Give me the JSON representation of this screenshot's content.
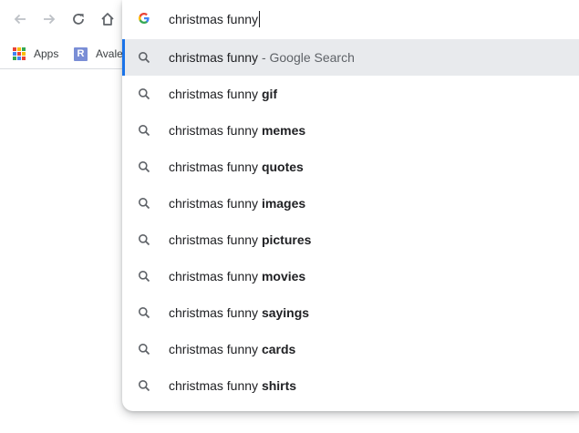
{
  "bookmarks": {
    "apps_label": "Apps",
    "avale_icon_letter": "R",
    "avale_label": "Avale"
  },
  "omnibox": {
    "value": "christmas funny"
  },
  "colors": {
    "accent": "#1a73e8",
    "selected_bg": "#e8eaed"
  },
  "suggestions": [
    {
      "prefix": "christmas funny",
      "suffix": "",
      "secondary": "- Google Search"
    },
    {
      "prefix": "christmas funny",
      "suffix": "gif",
      "secondary": ""
    },
    {
      "prefix": "christmas funny",
      "suffix": "memes",
      "secondary": ""
    },
    {
      "prefix": "christmas funny",
      "suffix": "quotes",
      "secondary": ""
    },
    {
      "prefix": "christmas funny",
      "suffix": "images",
      "secondary": ""
    },
    {
      "prefix": "christmas funny",
      "suffix": "pictures",
      "secondary": ""
    },
    {
      "prefix": "christmas funny",
      "suffix": "movies",
      "secondary": ""
    },
    {
      "prefix": "christmas funny",
      "suffix": "sayings",
      "secondary": ""
    },
    {
      "prefix": "christmas funny",
      "suffix": "cards",
      "secondary": ""
    },
    {
      "prefix": "christmas funny",
      "suffix": "shirts",
      "secondary": ""
    }
  ]
}
